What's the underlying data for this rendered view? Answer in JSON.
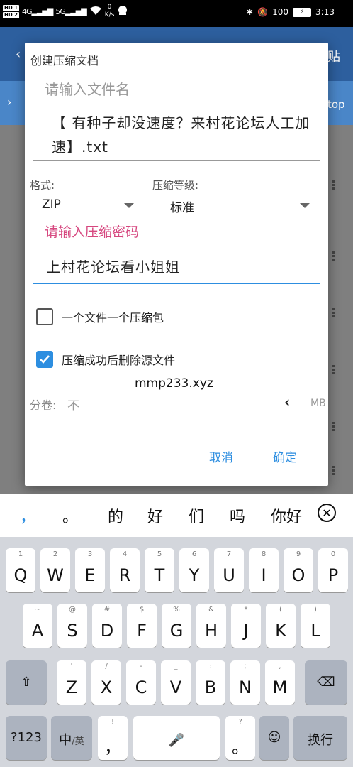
{
  "status_bar": {
    "hd1": "HD 1",
    "hd2": "HD 2",
    "net1": "4G",
    "net2": "5G",
    "speed_value": "0",
    "speed_unit": "K/s",
    "battery": "100",
    "time": "3:13"
  },
  "background": {
    "paste_label": "贴",
    "path_tail": "top"
  },
  "dialog": {
    "title": "创建压缩文档",
    "name_hint": "请输入文件名",
    "name_value": "【 有种子却没速度？来村花论坛人工加速】.txt",
    "format_label": "格式:",
    "format_value": "ZIP",
    "level_label": "压缩等级:",
    "level_value": "标准",
    "password_hint": "请输入压缩密码",
    "password_value": "上村花论坛看小姐姐",
    "option_one_per_file": "一个文件一个压缩包",
    "option_one_per_file_checked": false,
    "option_delete_source": "压缩成功后删除源文件",
    "option_delete_source_checked": true,
    "watermark": "mmp233.xyz",
    "volume_label": "分卷:",
    "volume_value": "不",
    "volume_unit": "MB",
    "cancel_label": "取消",
    "ok_label": "确定",
    "accent_color": "#2d8ee0",
    "hint_color": "#d6477f"
  },
  "candidates": {
    "items": [
      "，",
      "。",
      "的",
      "好",
      "们",
      "吗",
      "你好"
    ]
  },
  "keyboard": {
    "row1": [
      {
        "hint": "1",
        "key": "Q"
      },
      {
        "hint": "2",
        "key": "W"
      },
      {
        "hint": "3",
        "key": "E"
      },
      {
        "hint": "4",
        "key": "R"
      },
      {
        "hint": "5",
        "key": "T"
      },
      {
        "hint": "6",
        "key": "Y"
      },
      {
        "hint": "7",
        "key": "U"
      },
      {
        "hint": "8",
        "key": "I"
      },
      {
        "hint": "9",
        "key": "O"
      },
      {
        "hint": "0",
        "key": "P"
      }
    ],
    "row2": [
      {
        "hint": "~",
        "key": "A"
      },
      {
        "hint": "@",
        "key": "S"
      },
      {
        "hint": "#",
        "key": "D"
      },
      {
        "hint": "$",
        "key": "F"
      },
      {
        "hint": "%",
        "key": "G"
      },
      {
        "hint": "&",
        "key": "H"
      },
      {
        "hint": "*",
        "key": "J"
      },
      {
        "hint": "(",
        "key": "K"
      },
      {
        "hint": ")",
        "key": "L"
      }
    ],
    "row3": [
      {
        "hint": "'",
        "key": "Z"
      },
      {
        "hint": "/",
        "key": "X"
      },
      {
        "hint": "-",
        "key": "C"
      },
      {
        "hint": "_",
        "key": "V"
      },
      {
        "hint": ":",
        "key": "B"
      },
      {
        "hint": ";",
        "key": "N"
      },
      {
        "hint": ",",
        "key": "M"
      }
    ],
    "num_label": "?123",
    "lang_label": "中",
    "lang_sub": "/英",
    "comma_hint": "!",
    "comma_label": "，",
    "period_hint": "?",
    "period_label": "。",
    "enter_label": "换行"
  }
}
